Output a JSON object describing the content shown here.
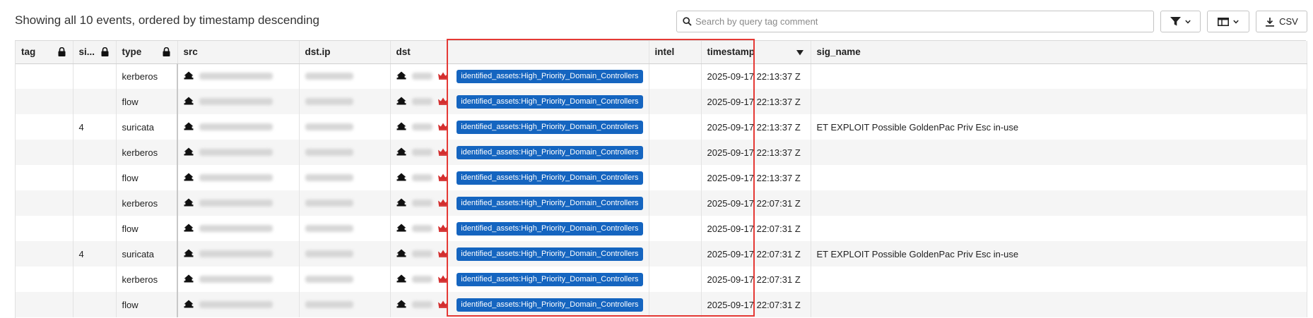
{
  "summary": "Showing all 10 events, ordered by timestamp descending",
  "search": {
    "placeholder": "Search by query tag comment"
  },
  "toolbar": {
    "csv_label": "CSV"
  },
  "columns": [
    {
      "key": "tag",
      "label": "tag",
      "locked": true
    },
    {
      "key": "sig",
      "label": "si...",
      "locked": true
    },
    {
      "key": "type",
      "label": "type",
      "locked": true
    },
    {
      "key": "src",
      "label": "src",
      "locked": false
    },
    {
      "key": "dst_ip",
      "label": "dst.ip",
      "locked": false
    },
    {
      "key": "dst",
      "label": "dst",
      "locked": false
    },
    {
      "key": "intel",
      "label": "intel",
      "locked": false
    },
    {
      "key": "timestamp",
      "label": "timestamp",
      "sort": "desc"
    },
    {
      "key": "sig_name",
      "label": "sig_name",
      "locked": false
    }
  ],
  "asset_badge": "identified_assets:High_Priority_Domain_Controllers",
  "rows": [
    {
      "sig": "",
      "type": "kerberos",
      "timestamp": "2025-09-17 22:13:37 Z",
      "sig_name": ""
    },
    {
      "sig": "",
      "type": "flow",
      "timestamp": "2025-09-17 22:13:37 Z",
      "sig_name": ""
    },
    {
      "sig": "4",
      "type": "suricata",
      "timestamp": "2025-09-17 22:13:37 Z",
      "sig_name": "ET EXPLOIT Possible GoldenPac Priv Esc in-use"
    },
    {
      "sig": "",
      "type": "kerberos",
      "timestamp": "2025-09-17 22:13:37 Z",
      "sig_name": ""
    },
    {
      "sig": "",
      "type": "flow",
      "timestamp": "2025-09-17 22:13:37 Z",
      "sig_name": ""
    },
    {
      "sig": "",
      "type": "kerberos",
      "timestamp": "2025-09-17 22:07:31 Z",
      "sig_name": ""
    },
    {
      "sig": "",
      "type": "flow",
      "timestamp": "2025-09-17 22:07:31 Z",
      "sig_name": ""
    },
    {
      "sig": "4",
      "type": "suricata",
      "timestamp": "2025-09-17 22:07:31 Z",
      "sig_name": "ET EXPLOIT Possible GoldenPac Priv Esc in-use"
    },
    {
      "sig": "",
      "type": "kerberos",
      "timestamp": "2025-09-17 22:07:31 Z",
      "sig_name": ""
    },
    {
      "sig": "",
      "type": "flow",
      "timestamp": "2025-09-17 22:07:31 Z",
      "sig_name": ""
    }
  ],
  "colors": {
    "badge": "#1565c0",
    "crown": "#d32f2f",
    "highlight": "#e53935"
  },
  "icons": {
    "lock": "lock-icon",
    "home": "home-icon",
    "crown": "crown-icon",
    "search": "search-icon",
    "filter": "filter-icon",
    "columns": "columns-icon",
    "download": "download-icon",
    "sort": "sort-desc-icon"
  }
}
